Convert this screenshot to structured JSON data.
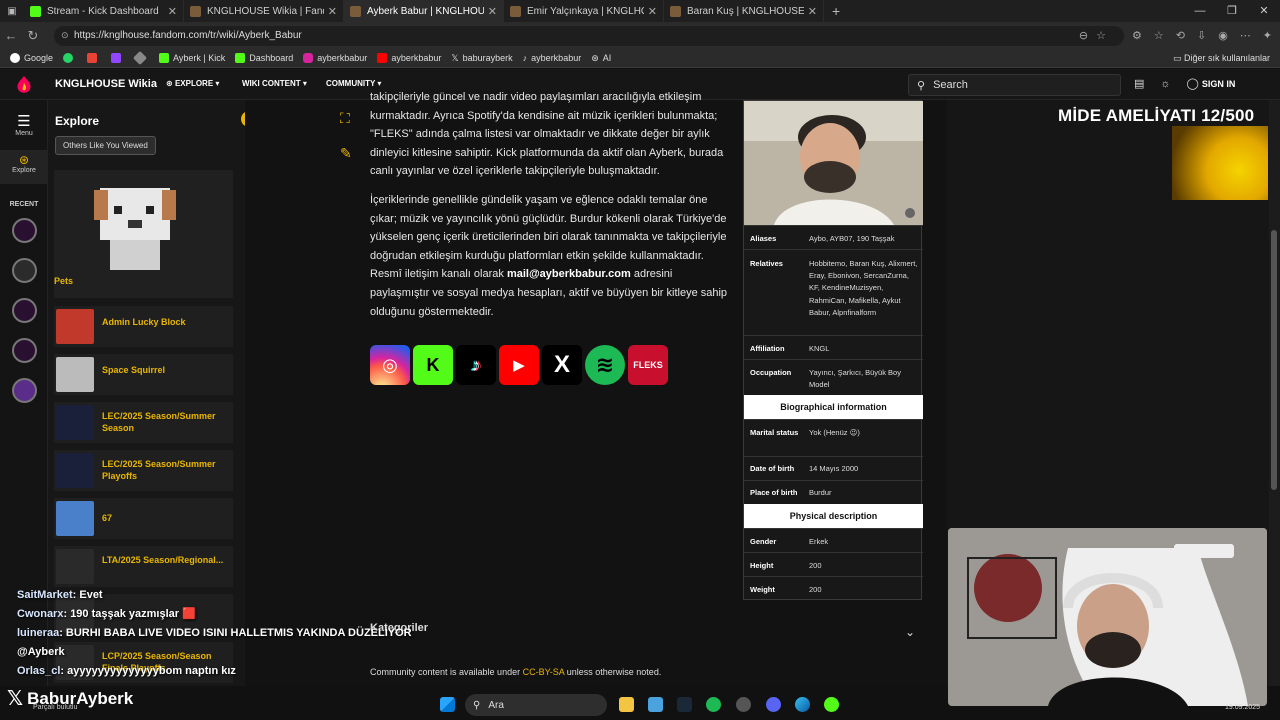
{
  "browser": {
    "tabs": [
      {
        "title": "Stream - Kick Dashboard",
        "color": "#53fc18"
      },
      {
        "title": "KNGLHOUSE Wikia | Fandom",
        "color": "#7a5c3a"
      },
      {
        "title": "Ayberk Babur | KNGLHOUSE Wiki",
        "color": "#7a5c3a",
        "active": true
      },
      {
        "title": "Emir Yalçınkaya | KNGLHOUSE Wi",
        "color": "#7a5c3a"
      },
      {
        "title": "Baran Kuş | KNGLHOUSE Wikia | F",
        "color": "#7a5c3a"
      }
    ],
    "url": "https://knglhouse.fandom.com/tr/wiki/Ayberk_Babur",
    "bookmarks": [
      "Google",
      "",
      "",
      "",
      "Ayberk | Kick",
      "Dashboard",
      "ayberkbabur",
      "ayberkbabur",
      "baburayberk",
      "ayberkbabur",
      "AI"
    ],
    "bookmarks_other": "Diğer sık kullanılanlar"
  },
  "fandom": {
    "wiki_name": "KNGLHOUSE Wikia",
    "menus": [
      "EXPLORE",
      "WIKI CONTENT",
      "COMMUNITY"
    ],
    "search_placeholder": "Search",
    "sign_in": "SIGN IN",
    "rail": {
      "menu": "Menu",
      "explore": "Explore",
      "recent": "RECENT"
    }
  },
  "explore_panel": {
    "title": "Explore",
    "pill": "Others Like You Viewed",
    "pets_label": "Pets",
    "items": [
      {
        "label": "Admin Lucky Block",
        "color": "#c0392b"
      },
      {
        "label": "Space Squirrel",
        "color": "#bbbbbb"
      },
      {
        "label": "LEC/2025 Season/Summer Season",
        "color": "#1a1f3a"
      },
      {
        "label": "LEC/2025 Season/Summer Playoffs",
        "color": "#1a1f3a"
      },
      {
        "label": "67",
        "color": "#4a7fc9"
      },
      {
        "label": "LTA/2025 Season/Regional...",
        "color": "#2a2a2a"
      },
      {
        "label": "",
        "color": "#2a2a2a"
      },
      {
        "label": "LCP/2025 Season/Season Finals Playoffs",
        "color": "#2a2a2a"
      }
    ]
  },
  "article": {
    "para1_top": "takipçileriyle güncel ve nadir video paylaşımları aracılığıyla etkileşim kurmaktadır. Ayrıca Spotify'da kendisine ait müzik içerikleri bulunmakta; \"FLEKS\" adında çalma listesi var olmaktadır ve dikkate değer bir aylık dinleyici kitlesine sahiptir. Kick platformunda da aktif olan Ayberk, burada canlı yayınlar ve özel içeriklerle takipçileriyle buluşmaktadır.",
    "para2_a": "İçeriklerinde genellikle gündelik yaşam ve eğlence odaklı temalar öne çıkar; müzik ve yayıncılık yönü güçlüdür. Burdur kökenli olarak Türkiye'de yükselen genç içerik üreticilerinden biri olarak tanınmakta ve takipçileriyle doğrudan etkileşim kurduğu platformları etkin şekilde kullanmaktadır. Resmî iletişim kanalı olarak ",
    "email": "mail@ayberkbabur.com",
    "para2_b": " adresini paylaşmıştır ve sosyal medya hesapları, aktif ve büyüyen bir kitleye sahip olduğunu göstermektedir.",
    "social": [
      {
        "name": "instagram",
        "glyph": "◎"
      },
      {
        "name": "kick",
        "glyph": "K"
      },
      {
        "name": "tiktok",
        "glyph": "♪"
      },
      {
        "name": "youtube",
        "glyph": "▶"
      },
      {
        "name": "x",
        "glyph": "X"
      },
      {
        "name": "spotify",
        "glyph": "≋"
      },
      {
        "name": "fleks",
        "glyph": "FLEKS"
      }
    ],
    "categories": "Kategoriler",
    "license_pre": "Community content is available under ",
    "license_link": "CC-BY-SA",
    "license_post": " unless otherwise noted."
  },
  "infobox": {
    "aliases_k": "Aliases",
    "aliases_v": "Aybo, AYB07, 190 Taşşak",
    "relatives_k": "Relatives",
    "relatives_v": "Hobbitemo, Baran Kuş, Alixmert, Eray, Ebonivon, SercanZurna, KF, KendineMuzisyen, RahmiCan, Mafikella, Aykut Babur, Alpnfinalform",
    "affiliation_k": "Affiliation",
    "affiliation_v": "KNGL",
    "occupation_k": "Occupation",
    "occupation_v": "Yayıncı, Şarkıcı, Büyük Boy Model",
    "bio_head": "Biographical information",
    "marital_k": "Marital status",
    "marital_v": "Yok (Henüz 😉)",
    "dob_k": "Date of birth",
    "dob_v": "14 Mayıs 2000",
    "pob_k": "Place of birth",
    "pob_v": "Burdur",
    "phys_head": "Physical description",
    "gender_k": "Gender",
    "gender_v": "Erkek",
    "height_k": "Height",
    "height_v": "200",
    "weight_k": "Weight",
    "weight_v": "200"
  },
  "stream_overlay": {
    "goal_text": "MİDE AMELİYATI 12/500",
    "chat": [
      {
        "user": "SaitMarket",
        "msg": ": Evet"
      },
      {
        "user": "Cwonarx",
        "msg": ": 190 taşşak yazmışlar 🟥"
      },
      {
        "user": "luineraa",
        "msg": ": BURHI BABA LIVE VIDEO ISINI HALLETMIS YAKINDA DÜZELİYOR"
      },
      {
        "user": "@Ayberk",
        "msg": ""
      },
      {
        "user": "Orlas_cl",
        "msg": ": ayyyyyyyyyyyyyybom naptın kız"
      }
    ],
    "brand": "BaburAyberk",
    "brand_sub": "Parçalı bulutlu"
  },
  "taskbar": {
    "search": "Ara",
    "date": "19.09.2025"
  }
}
